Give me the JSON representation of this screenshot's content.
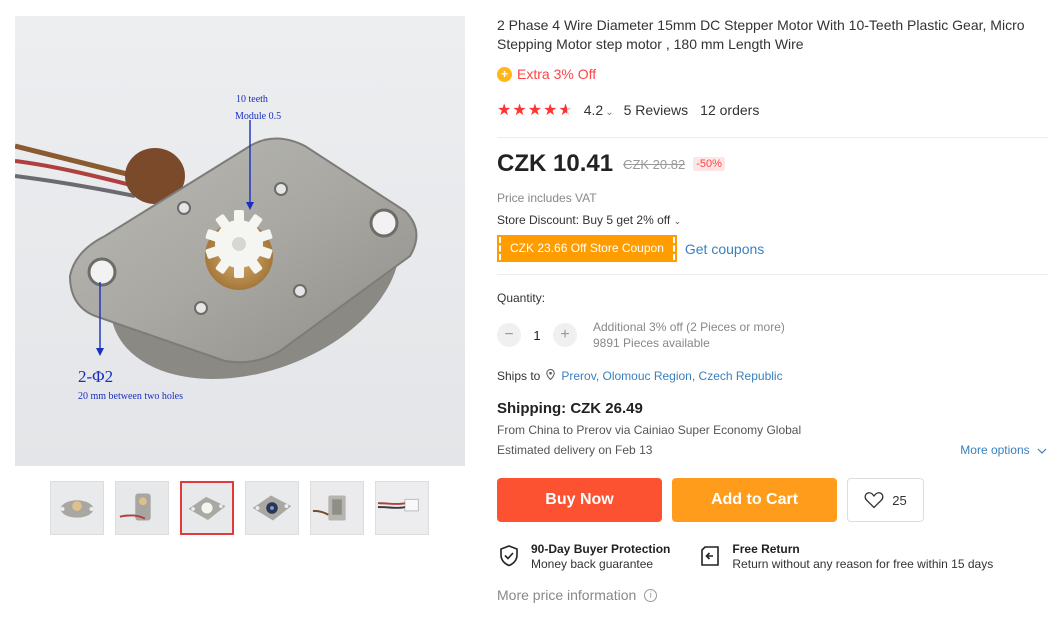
{
  "gallery": {
    "annotation_teeth": "10 teeth",
    "annotation_module": "Module 0.5",
    "annotation_holes": "2-Φ2",
    "annotation_distance": "20 mm between two holes",
    "thumbnails_count": 6,
    "active_thumbnail": 3
  },
  "product": {
    "title": "2 Phase 4 Wire Diameter 15mm DC Stepper Motor With 10-Teeth Plastic Gear, Micro Stepping Motor step motor , 180 mm Length Wire",
    "extra_offer": "Extra 3% Off",
    "rating_value": "4.2",
    "rating_stars": 4.5,
    "reviews": "5 Reviews",
    "orders": "12 orders"
  },
  "price": {
    "current": "CZK 10.41",
    "original": "CZK 20.82",
    "discount": "-50%",
    "vat_note": "Price includes VAT",
    "store_discount": "Store Discount: Buy 5 get 2% off",
    "coupon": "CZK 23.66 Off Store Coupon",
    "get_coupons": "Get coupons"
  },
  "quantity": {
    "label": "Quantity:",
    "minus": "−",
    "value": "1",
    "plus": "+",
    "additional": "Additional 3% off (2 Pieces or more)",
    "available": "9891 Pieces available"
  },
  "shipping": {
    "ships_to_label": "Ships to",
    "location": "Prerov, Olomouc Region, Czech Republic",
    "title": "Shipping: CZK 26.49",
    "from": "From China to Prerov via Cainiao Super Economy Global",
    "delivery": "Estimated delivery on Feb 13",
    "more_options": "More options"
  },
  "actions": {
    "buy_now": "Buy Now",
    "add_to_cart": "Add to Cart",
    "wishlist_count": "25"
  },
  "guarantees": {
    "protection_title": "90-Day Buyer Protection",
    "protection_sub": "Money back guarantee",
    "return_title": "Free Return",
    "return_sub": "Return without any reason for free within 15 days"
  },
  "footer": {
    "more_price_info": "More price information"
  },
  "colors": {
    "price_red": "#f44444",
    "buy_now": "#fd5231",
    "add_to_cart": "#ff9c1c",
    "link_blue": "#3a80c0",
    "coupon_orange": "#ff9c00"
  }
}
